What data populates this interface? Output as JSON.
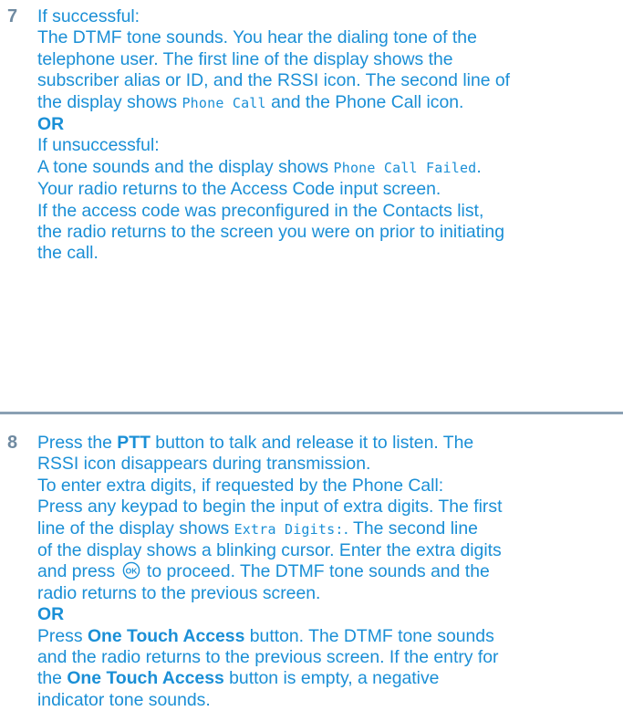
{
  "step7": {
    "number": "7",
    "if_successful": "If successful:",
    "success_l1": "The DTMF tone sounds. You hear the dialing tone of the",
    "success_l2": "telephone user. The first line of the display shows the",
    "success_l3": "subscriber alias or ID, and the RSSI icon. The second line of",
    "success_l4a": "the display shows ",
    "success_l4_code": "Phone Call",
    "success_l4b": " and the Phone Call icon.",
    "or": "OR",
    "if_unsuccessful": "If unsuccessful:",
    "fail_l1a": "A tone sounds and the display shows ",
    "fail_l1_code": "Phone Call Failed",
    "fail_l1b": ".",
    "fail_l2": "Your radio returns to the Access Code input screen.",
    "fail_l3": "If the access code was preconfigured in the Contacts list,",
    "fail_l4": "the radio returns to the screen you were on prior to initiating",
    "fail_l5": "the call."
  },
  "step8": {
    "number": "8",
    "l1a": "Press the ",
    "l1_bold": "PTT",
    "l1b": " button to talk and release it to listen. The",
    "l2": "RSSI icon disappears during transmission.",
    "l3": "To enter extra digits, if requested by the Phone Call:",
    "l4": "Press any keypad to begin the input of extra digits. The first",
    "l5a": "line of the display shows ",
    "l5_code": "Extra Digits:",
    "l5b": ". The second line",
    "l6": "of the display shows a blinking cursor. Enter the extra digits",
    "l7a": "and press ",
    "l7b": " to proceed. The DTMF tone sounds and the",
    "l8": "radio returns to the previous screen.",
    "or": "OR",
    "l9a": "Press ",
    "l9_bold": "One Touch Access",
    "l9b": " button. The DTMF tone sounds",
    "l10": "and the radio returns to the previous screen. If the entry for",
    "l11a": "the ",
    "l11_bold": "One Touch Access",
    "l11b": " button is empty, a negative",
    "l12": "indicator tone sounds."
  },
  "icons": {
    "ok_button": "ok-button-icon"
  },
  "colors": {
    "text": "#1a8fd6",
    "step_number": "#6f8aa1",
    "divider": "#8aa0b3"
  }
}
